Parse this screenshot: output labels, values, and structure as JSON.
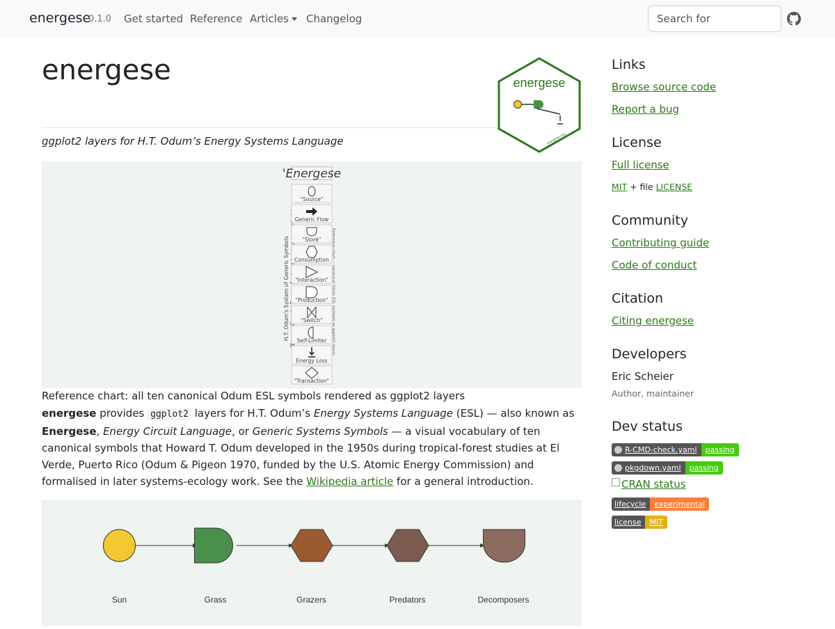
{
  "navbar": {
    "brand": "energese",
    "version": "0.1.0",
    "links": [
      "Get started",
      "Reference",
      "Articles",
      "Changelog"
    ],
    "search_placeholder": "Search for",
    "github_icon": "github-icon"
  },
  "header": {
    "title": "energese",
    "tagline": "ggplot2 layers for H.T. Odum’s Energy Systems Language",
    "logo_text": "energese",
    "logo_caption": "energese.org"
  },
  "reference_chart": {
    "title": "'Energese",
    "labels": [
      "\"Source\"",
      "Generic Flow",
      "\"Store\"",
      "Consumption",
      "\"Interaction\"",
      "\"Production\"",
      "\"Switch\"",
      "Self-Limiter",
      "Energy Loss",
      "\"Transaction\""
    ],
    "left_vertical_1": "H.T. Odum's System of Generic Symbols",
    "left_vertical_2": "(Energy Circuit / Energy Systems Language symbols)",
    "right_vertical": "Reference chart — canonical Odum ESL symbols as ggplot2 layers",
    "caption": "Reference chart: all ten canonical Odum ESL symbols rendered as ggplot2 layers"
  },
  "intro": {
    "pkg": "energese",
    "provides": "provides",
    "code": "ggplot2",
    "layers_for": "layers for H.T. Odum’s",
    "esl": "Energy Systems Language",
    "esl_abbr": "(ESL) — also known as",
    "alias1": "Energese",
    "comma": ",",
    "alias2": "Energy Circuit Language",
    "or": ", or",
    "alias3": "Generic Systems Symbols",
    "rest": "— a visual vocabulary of ten canonical symbols that Howard T. Odum developed in the 1950s during tropical-forest studies at El Verde, Puerto Rico (Odum & Pigeon 1970, funded by the U.S. Atomic Energy Commission) and formalised in later systems-ecology work. See the",
    "link": "Wikipedia article",
    "tail": "for a general introduction."
  },
  "food_chain": {
    "nodes": [
      "Sun",
      "Grass",
      "Grazers",
      "Predators",
      "Decomposers"
    ],
    "colors": [
      "#f4c830",
      "#4a8f4a",
      "#9b5a30",
      "#7b5a50",
      "#8d6a60"
    ]
  },
  "sidebar": {
    "links_heading": "Links",
    "links": [
      "Browse source code",
      "Report a bug"
    ],
    "license_heading": "License",
    "full_license": "Full license",
    "license_mit": "MIT",
    "license_file": "+ file",
    "license_file_link": "LICENSE",
    "community_heading": "Community",
    "community_links": [
      "Contributing guide",
      "Code of conduct"
    ],
    "citation_heading": "Citation",
    "citation_link": "Citing energese",
    "developers_heading": "Developers",
    "developer_name": "Eric Scheier",
    "developer_role": "Author, maintainer",
    "devstatus_heading": "Dev status",
    "badges": [
      {
        "left": "R-CMD-check.yaml",
        "right": "passing",
        "color": "#4c1"
      },
      {
        "left": "pkgdown.yaml",
        "right": "passing",
        "color": "#4c1"
      },
      {
        "left": "lifecycle",
        "right": "experimental",
        "color": "#fe7d37"
      },
      {
        "left": "license",
        "right": "MIT",
        "color": "#dfb317"
      }
    ],
    "cran_alt": "CRAN status"
  }
}
